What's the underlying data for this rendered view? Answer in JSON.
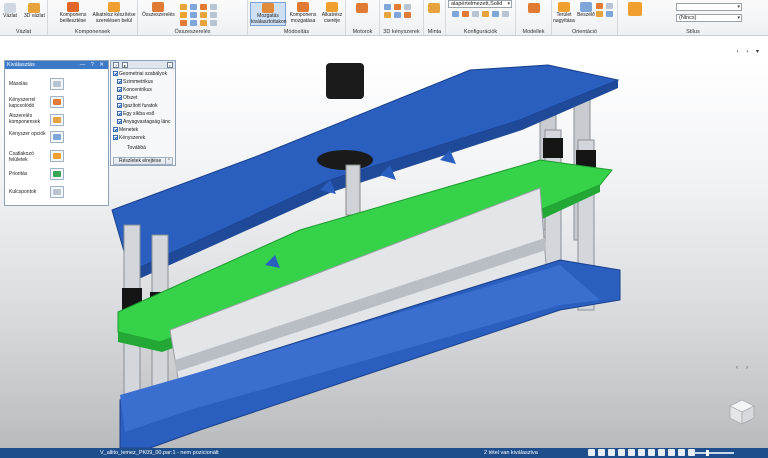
{
  "ribbon": {
    "groups": [
      {
        "label": "Vázlat",
        "buttons": [
          {
            "label": "Vázlat"
          },
          {
            "label": "3D vázlat"
          }
        ]
      },
      {
        "label": "Komponensek",
        "buttons": [
          {
            "label": "Komponens beillesztése"
          },
          {
            "label": "Alkatrész készítése szerelésen belül"
          }
        ]
      },
      {
        "label": "Összeszerelés",
        "buttons": [
          {
            "label": "Összeszerelés"
          }
        ]
      },
      {
        "label": "Módosítás",
        "buttons": [
          {
            "label": "Mozgatás kiválasztottakon"
          },
          {
            "label": "Komponens mozgatása"
          },
          {
            "label": "Alkatrész cseréje"
          }
        ]
      },
      {
        "label": "Motorok",
        "buttons": []
      },
      {
        "label": "3D kényszerek",
        "buttons": []
      },
      {
        "label": "Minta",
        "buttons": []
      },
      {
        "label": "Konfigurációk",
        "buttons": []
      },
      {
        "label": "Modellek",
        "buttons": []
      },
      {
        "label": "Orientáció",
        "buttons": [
          {
            "label": "Terület nagyítása"
          },
          {
            "label": "Beszélő"
          }
        ]
      },
      {
        "label": "Stílus",
        "buttons": []
      }
    ],
    "config_combo": "alapértelmezett,Solid",
    "style_combo": "(Nincs)"
  },
  "selection_panel": {
    "title": "Kiválasztás",
    "items": [
      {
        "label": "Másolás",
        "icon": "copy-icon"
      },
      {
        "label": "Kényszerrel kapcsolódó",
        "icon": "constraint-icon"
      },
      {
        "label": "Alszerelés komponensek",
        "icon": "subassembly-icon"
      },
      {
        "label": "Kényszer opciók",
        "icon": "constraint-options-icon"
      },
      {
        "label": "Csatlakozó felületek",
        "icon": "surfaces-icon"
      },
      {
        "label": "Prioritás",
        "icon": "priority-icon"
      },
      {
        "label": "Kulcspontok",
        "icon": "keypoints-icon"
      }
    ]
  },
  "relations_panel": {
    "items": [
      {
        "label": "Geometriai szabályok",
        "indent": 0
      },
      {
        "label": "Szimmetrikus",
        "indent": 1
      },
      {
        "label": "Koncentrikus",
        "indent": 1
      },
      {
        "label": "Ofszet",
        "indent": 1
      },
      {
        "label": "Igazított furatok",
        "indent": 1
      },
      {
        "label": "Egy síkba eső",
        "indent": 1
      },
      {
        "label": "Anyagvastagság lánc",
        "indent": 1
      },
      {
        "label": "Menetek",
        "indent": 0
      },
      {
        "label": "Kényszerek",
        "indent": 0
      },
      {
        "label": "Továbbá",
        "indent": 2
      }
    ],
    "details_button": "Részletek elrejtése"
  },
  "status_bar": {
    "document": "V_allito_lemez_PK09_00.par:1 - nem pozicionált",
    "selection": "2 tétel van kiválasztva"
  },
  "colors": {
    "accent": "#3c79c7",
    "status_bar": "#1f4e8c",
    "model_blue": "#2a5fbf",
    "model_green": "#2ecc40"
  }
}
